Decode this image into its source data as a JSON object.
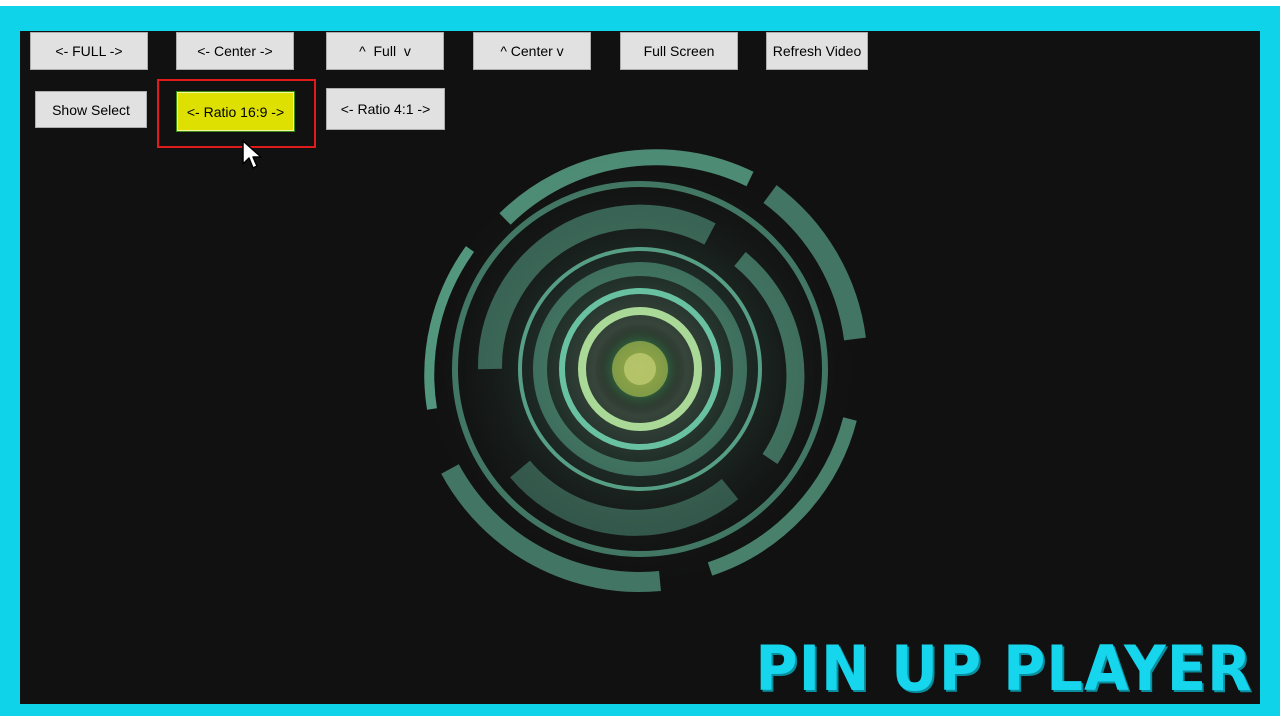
{
  "colors": {
    "frame": "#0fd3e8",
    "screen_bg": "#111111",
    "button_bg": "#e1e1e1",
    "active_button_bg": "#dde000",
    "highlight_border": "#e01b1b",
    "logo": "#16d6ee"
  },
  "toolbar_row1": [
    {
      "label": "<- FULL ->"
    },
    {
      "label": "<- Center ->"
    },
    {
      "label": "^  Full  v"
    },
    {
      "label": "^ Center v"
    },
    {
      "label": "Full Screen"
    },
    {
      "label": "Refresh Video"
    }
  ],
  "toolbar_row2": [
    {
      "label": "Show Select"
    },
    {
      "label": "<- Ratio 16:9 ->",
      "selected": true
    },
    {
      "label": "<- Ratio 4:1 ->"
    }
  ],
  "logo_text": "PIN UP PLAYER",
  "icons": {
    "emblem": "glowing-circular-hud-icon",
    "cursor": "mouse-pointer-icon"
  }
}
